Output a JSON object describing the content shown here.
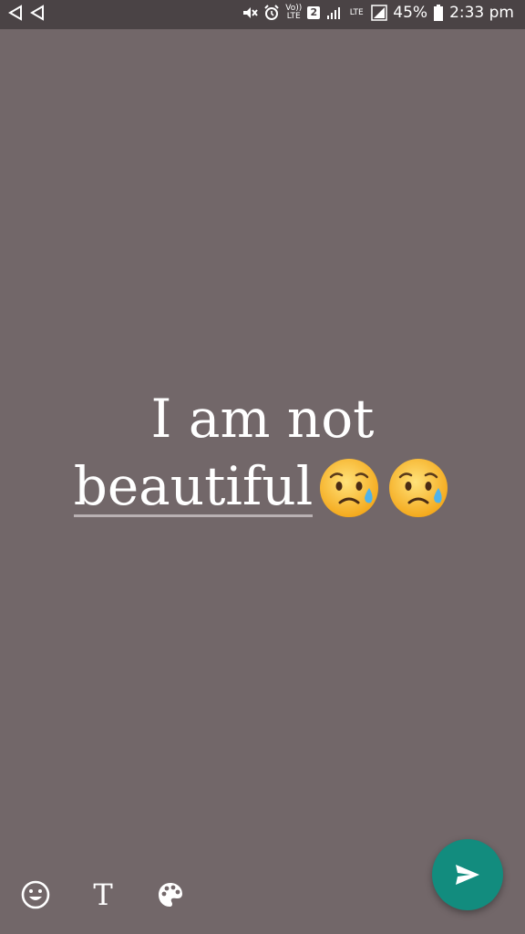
{
  "status_bar": {
    "battery_percent": "45%",
    "time": "2:33 pm",
    "volte_label": "Vo)) LTE",
    "sim_slot": "2",
    "lte_label": "LTE",
    "icons": [
      "back-arrow-icon",
      "back-arrow-icon",
      "mute-icon",
      "alarm-icon",
      "volte-icon",
      "sim-2-icon",
      "signal-icon",
      "lte-icon",
      "signal-icon",
      "battery-icon"
    ]
  },
  "story": {
    "line1": "I am not",
    "line2": "beautiful",
    "emojis": [
      "sad-sweat-emoji",
      "sad-sweat-emoji"
    ],
    "background_color": "#726769",
    "text_color": "#ffffff"
  },
  "toolbar": {
    "emoji_icon": "emoji-icon",
    "text_tool_label": "T",
    "palette_icon": "palette-icon"
  },
  "send_button": {
    "icon": "send-icon",
    "color": "#128c7e"
  }
}
